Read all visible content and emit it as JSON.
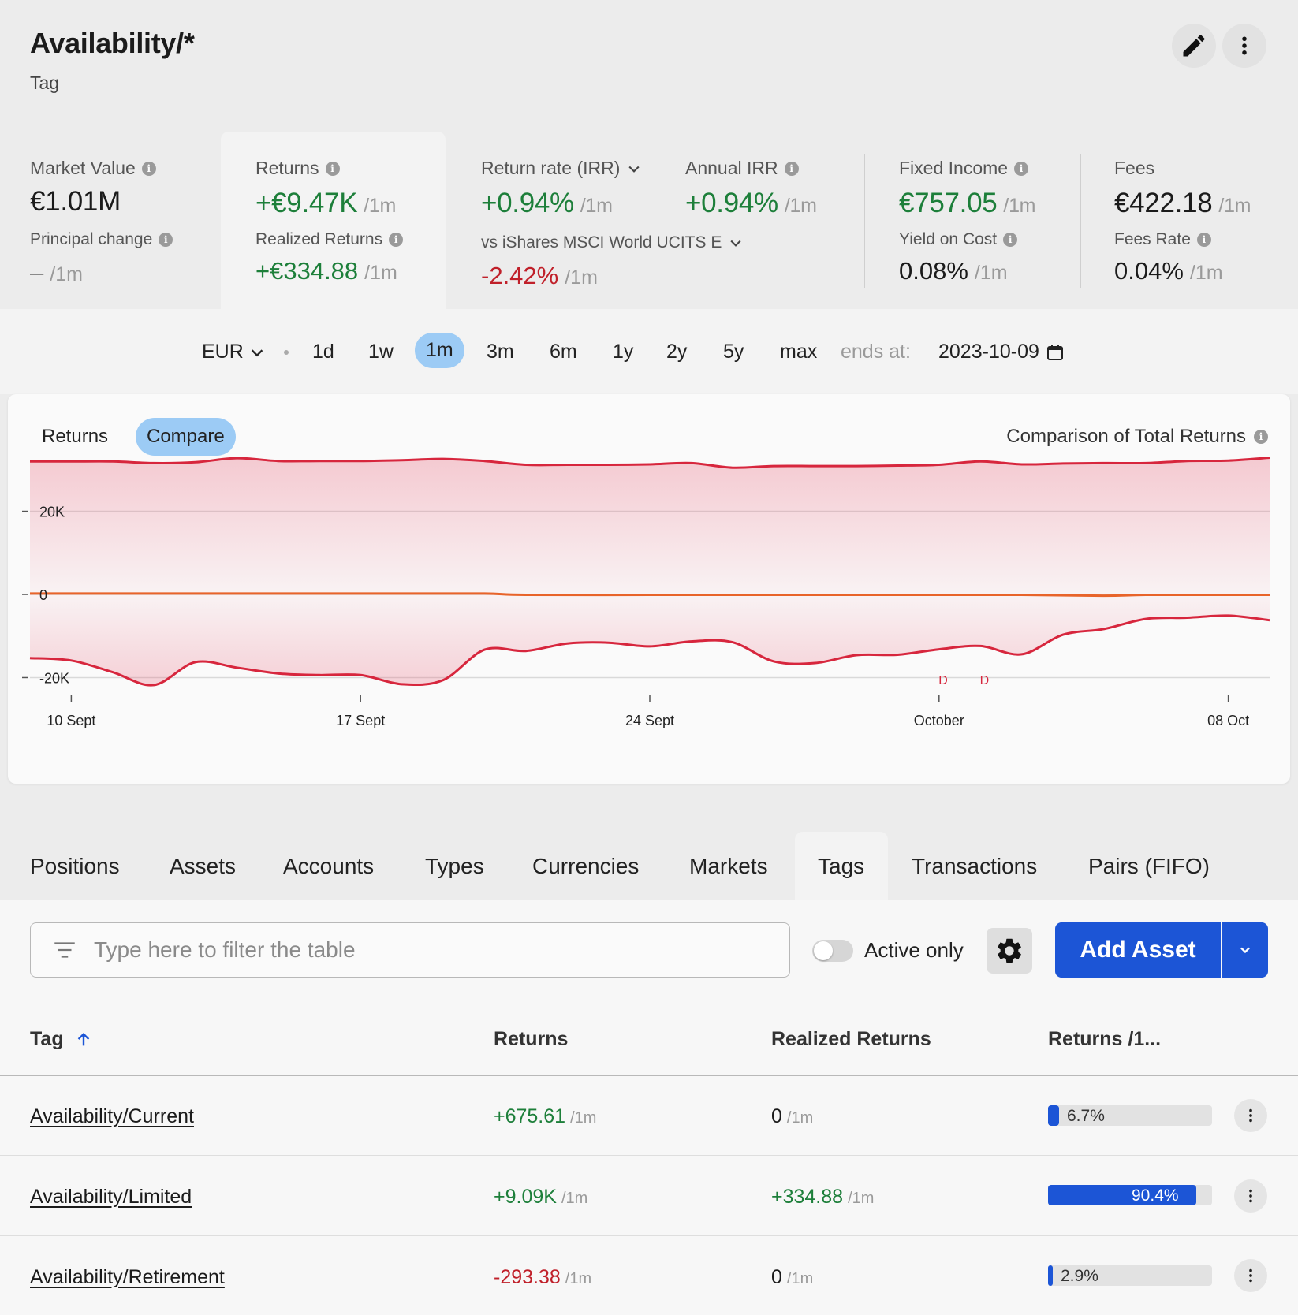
{
  "header": {
    "title": "Availability/*",
    "subtitle": "Tag",
    "edit_icon": "pencil-icon",
    "more_icon": "kebab-icon"
  },
  "stats": {
    "market_value": {
      "label": "Market Value",
      "value": "€1.01M",
      "sub_label": "Principal change",
      "sub_value": "–",
      "sub_period": "/1m"
    },
    "returns": {
      "label": "Returns",
      "value": "+€9.47K",
      "period": "/1m",
      "sub_label": "Realized Returns",
      "sub_value": "+€334.88",
      "sub_period": "/1m"
    },
    "return_rate": {
      "label": "Return rate (IRR)",
      "value": "+0.94%",
      "period": "/1m",
      "vs_label": "vs iShares MSCI World UCITS E",
      "vs_value": "-2.42%",
      "vs_period": "/1m"
    },
    "annual_irr": {
      "label": "Annual IRR",
      "value": "+0.94%",
      "period": "/1m"
    },
    "fixed_income": {
      "label": "Fixed Income",
      "value": "€757.05",
      "period": "/1m",
      "sub_label": "Yield on Cost",
      "sub_value": "0.08%",
      "sub_period": "/1m"
    },
    "fees": {
      "label": "Fees",
      "value": "€422.18",
      "period": "/1m",
      "sub_label": "Fees Rate",
      "sub_value": "0.04%",
      "sub_period": "/1m"
    }
  },
  "timebar": {
    "currency": "EUR",
    "periods": [
      "1d",
      "1w",
      "1m",
      "3m",
      "6m",
      "1y",
      "2y",
      "5y",
      "max"
    ],
    "active_period": "1m",
    "ends_label": "ends at:",
    "ends_value": "2023-10-09"
  },
  "chart": {
    "tabs": [
      "Returns",
      "Compare"
    ],
    "active_tab": "Compare",
    "title": "Comparison of Total Returns"
  },
  "chart_data": {
    "type": "line",
    "title": "Comparison of Total Returns",
    "x_ticks": [
      "10 Sept",
      "17 Sept",
      "24 Sept",
      "October",
      "08 Oct"
    ],
    "x_tick_days": [
      0,
      7,
      14,
      21,
      28
    ],
    "y_ticks": [
      -20000,
      0,
      20000
    ],
    "y_tick_labels": [
      "-20K",
      "0",
      "20K"
    ],
    "ylim": [
      -22000,
      33000
    ],
    "x_range": [
      -1,
      29
    ],
    "grid": true,
    "markers": [
      {
        "label": "D",
        "x": 21.1
      },
      {
        "label": "D",
        "x": 22.1
      }
    ],
    "series": [
      {
        "color": "#d7263d",
        "fill": true,
        "x": [
          -1,
          0,
          1,
          2,
          3,
          4,
          5,
          6,
          7,
          8,
          9,
          10,
          11,
          12,
          13,
          14,
          15,
          16,
          17,
          18,
          19,
          20,
          21,
          22,
          23,
          24,
          25,
          26,
          27,
          28,
          29
        ],
        "values": [
          32000,
          32000,
          32000,
          31600,
          31800,
          32800,
          32100,
          32100,
          32100,
          32300,
          32600,
          32100,
          31200,
          31200,
          31200,
          31300,
          31600,
          30500,
          30900,
          30900,
          30900,
          31000,
          31200,
          32000,
          31300,
          31500,
          31600,
          31600,
          32100,
          32200,
          32900
        ]
      },
      {
        "color": "#e8642a",
        "fill": false,
        "x": [
          -1,
          2,
          5,
          8,
          10,
          11,
          14,
          17,
          20,
          23,
          25,
          26,
          28,
          29
        ],
        "values": [
          200,
          200,
          200,
          200,
          200,
          -100,
          -100,
          -100,
          -100,
          -100,
          -300,
          -100,
          -100,
          -100
        ]
      },
      {
        "color": "#d7263d",
        "fill": true,
        "x": [
          -1,
          0,
          1,
          2,
          3,
          4,
          5,
          6,
          7,
          8,
          9,
          10,
          11,
          12,
          13,
          14,
          15,
          16,
          17,
          18,
          19,
          20,
          21,
          22,
          23,
          24,
          25,
          26,
          27,
          28,
          29
        ],
        "values": [
          -15300,
          -15900,
          -18700,
          -21800,
          -16300,
          -17600,
          -19000,
          -19400,
          -19400,
          -21600,
          -20600,
          -13300,
          -13600,
          -11800,
          -11600,
          -12500,
          -11300,
          -11500,
          -16100,
          -16500,
          -14600,
          -14500,
          -13200,
          -12400,
          -14400,
          -9700,
          -8300,
          -5900,
          -5600,
          -5100,
          -6200
        ]
      }
    ]
  },
  "tabs": {
    "items": [
      "Positions",
      "Assets",
      "Accounts",
      "Types",
      "Currencies",
      "Markets",
      "Tags",
      "Transactions",
      "Pairs (FIFO)"
    ],
    "active": "Tags"
  },
  "toolbar": {
    "filter_placeholder": "Type here to filter the table",
    "filter_icon": "filter-icon",
    "active_only_label": "Active only",
    "active_only": false,
    "settings_icon": "gear-icon",
    "add_label": "Add Asset",
    "add_dropdown_icon": "chevron-down-icon"
  },
  "table": {
    "columns": [
      "Tag",
      "Returns",
      "Realized Returns",
      "Returns /1..."
    ],
    "sort_column": "Tag",
    "sort_direction": "ascending",
    "rows": [
      {
        "tag": "Availability/Current",
        "returns": "+675.61",
        "returns_period": "/1m",
        "returns_sign": "pos",
        "realized": "0",
        "realized_period": "/1m",
        "realized_sign": "zero",
        "share_label": "6.7%",
        "share_fraction": 0.067
      },
      {
        "tag": "Availability/Limited",
        "returns": "+9.09K",
        "returns_period": "/1m",
        "returns_sign": "pos",
        "realized": "+334.88",
        "realized_period": "/1m",
        "realized_sign": "pos",
        "share_label": "90.4%",
        "share_fraction": 0.904
      },
      {
        "tag": "Availability/Retirement",
        "returns": "-293.38",
        "returns_period": "/1m",
        "returns_sign": "neg",
        "realized": "0",
        "realized_period": "/1m",
        "realized_sign": "zero",
        "share_label": "2.9%",
        "share_fraction": 0.029
      }
    ]
  },
  "colors": {
    "positive": "#1d7f3a",
    "negative": "#c0202a",
    "accent": "#1c55d6",
    "pill": "#9ccbf5"
  }
}
